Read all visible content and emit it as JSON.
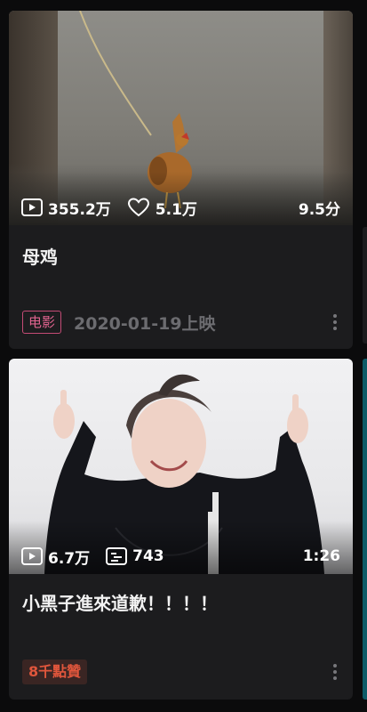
{
  "feed": {
    "cards": [
      {
        "plays": "355.2万",
        "likes": "5.1万",
        "score": "9.5分",
        "title": "母鸡",
        "tag": "电影",
        "date": "2020-01-19上映",
        "icons": [
          "play-icon",
          "heart-icon",
          "more-icon"
        ]
      },
      {
        "plays": "6.7万",
        "comments": "743",
        "duration": "1:26",
        "title": "小黑子進來道歉！！！！",
        "tag": "8千點贊",
        "icons": [
          "play-icon",
          "danmaku-icon",
          "more-icon"
        ]
      }
    ]
  },
  "colors": {
    "background": "#0b0b0c",
    "card": "#1c1c1e",
    "movie_tag": "#e0648f",
    "likes_tag": "#e0563c",
    "peek_teal": "#0d5b67"
  }
}
